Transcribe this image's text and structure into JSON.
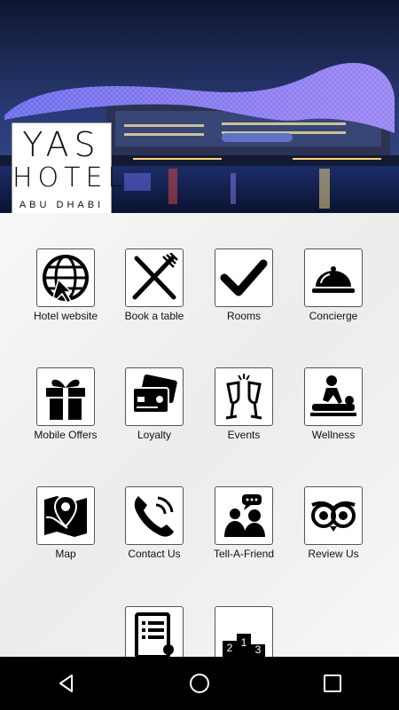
{
  "header": {
    "logo_line1": "YAS",
    "logo_line2": "HOTEL",
    "logo_line3": "ABU DHABI"
  },
  "grid": [
    {
      "label": "Hotel website",
      "icon": "globe-icon"
    },
    {
      "label": "Book a table",
      "icon": "fork-knife-icon"
    },
    {
      "label": "Rooms",
      "icon": "checkmark-icon"
    },
    {
      "label": "Concierge",
      "icon": "cloche-icon"
    },
    {
      "label": "Mobile Offers",
      "icon": "gift-icon"
    },
    {
      "label": "Loyalty",
      "icon": "credit-cards-icon"
    },
    {
      "label": "Events",
      "icon": "champagne-glasses-icon"
    },
    {
      "label": "Wellness",
      "icon": "massage-icon"
    },
    {
      "label": "Map",
      "icon": "map-pin-icon"
    },
    {
      "label": "Contact Us",
      "icon": "phone-icon"
    },
    {
      "label": "Tell-A-Friend",
      "icon": "people-chat-icon"
    },
    {
      "label": "Review Us",
      "icon": "owl-icon"
    },
    {
      "label": "",
      "icon": "document-list-icon"
    },
    {
      "label": "",
      "icon": "podium-icon"
    }
  ],
  "navbar": {
    "buttons": [
      "back-icon",
      "home-icon",
      "recents-icon"
    ]
  }
}
